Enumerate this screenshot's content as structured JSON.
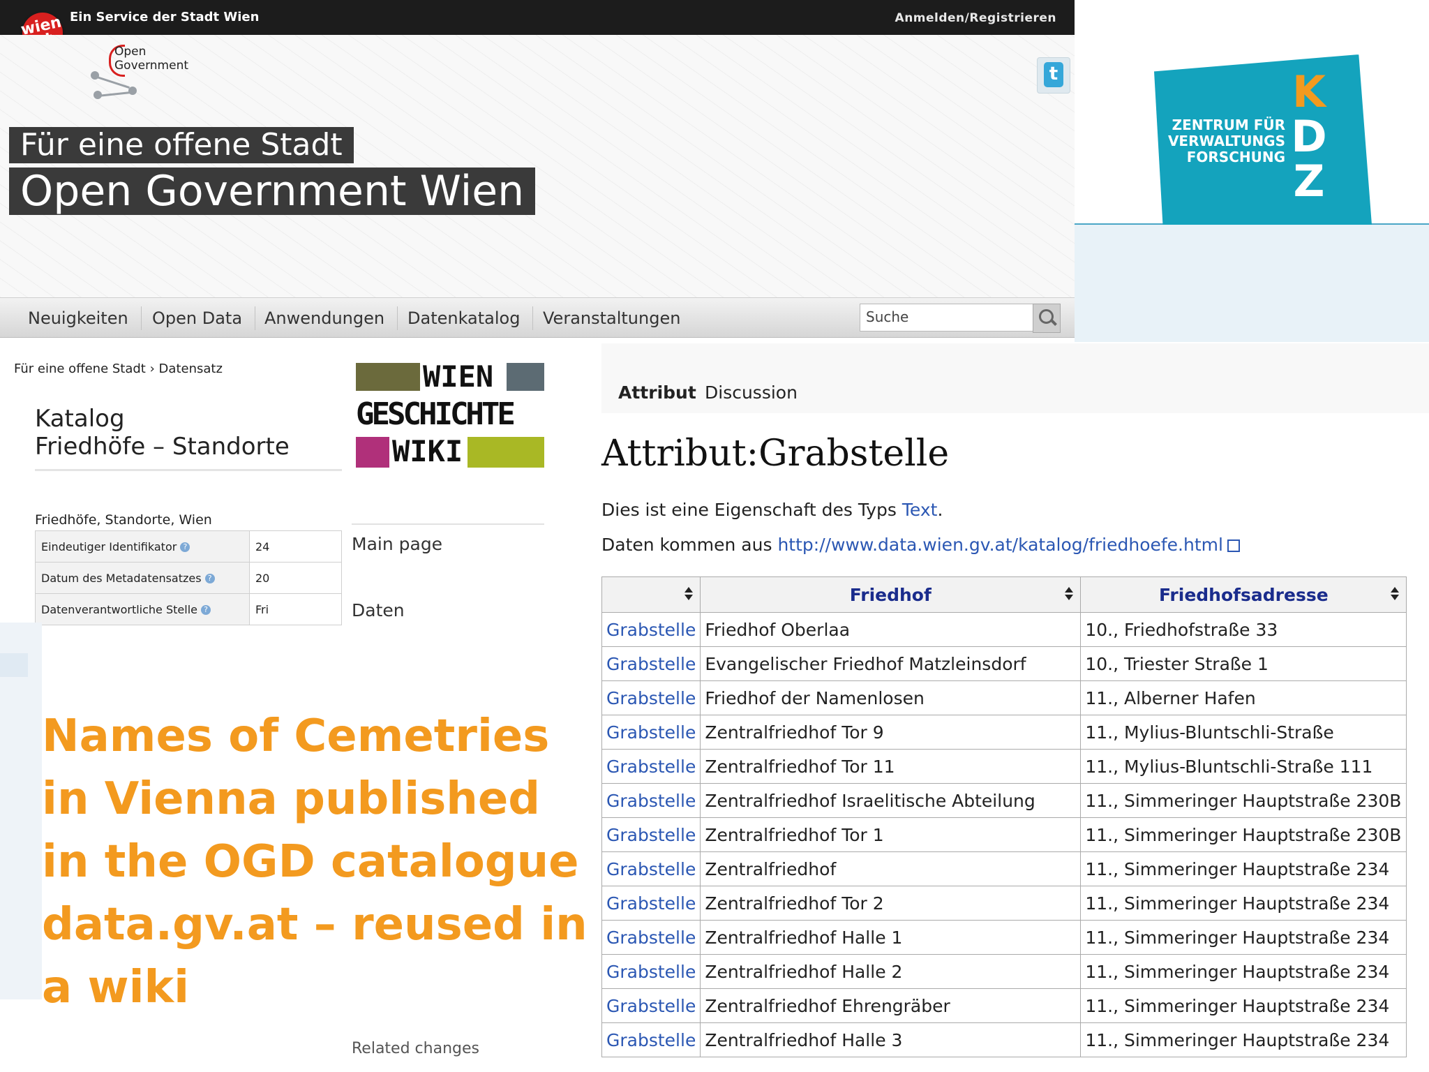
{
  "topbar": {
    "wien_logo": "wien at",
    "service": "Ein Service der Stadt Wien",
    "login": "Anmelden/Registrieren"
  },
  "header": {
    "og_logo": "Open Government",
    "title_small": "Für eine offene Stadt",
    "title_big": "Open Government Wien",
    "twitter_icon": "twitter-icon"
  },
  "nav": {
    "items": [
      "Neuigkeiten",
      "Open Data",
      "Anwendungen",
      "Datenkatalog",
      "Veranstaltungen"
    ],
    "search_placeholder": "Suche"
  },
  "kdz": {
    "line1": "ZENTRUM FÜR",
    "line2": "VERWALTUNGS",
    "line3": "FORSCHUNG",
    "letters": [
      "K",
      "D",
      "Z"
    ],
    "color": "#14a3bd",
    "accent": "#f39a1f"
  },
  "left": {
    "breadcrumb_1": "Für eine offene Stadt",
    "breadcrumb_2": "Datensatz",
    "katalog_line1": "Katalog",
    "katalog_line2": "Friedhöfe – Standorte",
    "subhead": "Friedhöfe, Standorte, Wien",
    "meta": [
      {
        "key": "Eindeutiger Identifikator",
        "value": "24"
      },
      {
        "key": "Datum des Metadatensatzes",
        "value": "20"
      },
      {
        "key": "Datenverantwortliche Stelle",
        "value": "Fri"
      }
    ]
  },
  "wgw_logo": {
    "line1": "WIEN",
    "line2": "GESCHICHTE",
    "line3": "WIKI"
  },
  "wiki_nav": {
    "main": "Main page",
    "daten": "Daten",
    "related": "Related changes"
  },
  "headline": {
    "line1": "Names of Cemetries",
    "line2": "in Vienna published",
    "line3": "in the OGD catalogue",
    "line4": "data.gv.at – reused in",
    "line5": "a wiki",
    "color": "#f39a1f"
  },
  "wiki": {
    "tab_attribut": "Attribut",
    "tab_discussion": "Discussion",
    "title": "Attribut:Grabstelle",
    "p1_prefix": "Dies ist eine Eigenschaft des Typs",
    "p1_link": "Text",
    "p1_suffix": ".",
    "p2_prefix": "Daten kommen aus",
    "p2_link": "http://www.data.wien.gv.at/katalog/friedhoefe.html",
    "table": {
      "headers": [
        "",
        "Friedhof",
        "Friedhofsadresse"
      ],
      "rows": [
        [
          "Grabstelle",
          "Friedhof Oberlaa",
          "10., Friedhofstraße 33"
        ],
        [
          "Grabstelle",
          "Evangelischer Friedhof Matzleinsdorf",
          "10., Triester Straße 1"
        ],
        [
          "Grabstelle",
          "Friedhof der Namenlosen",
          "11., Alberner Hafen"
        ],
        [
          "Grabstelle",
          "Zentralfriedhof Tor 9",
          "11., Mylius-Bluntschli-Straße"
        ],
        [
          "Grabstelle",
          "Zentralfriedhof Tor 11",
          "11., Mylius-Bluntschli-Straße 111"
        ],
        [
          "Grabstelle",
          "Zentralfriedhof Israelitische Abteilung",
          "11., Simmeringer Hauptstraße 230B"
        ],
        [
          "Grabstelle",
          "Zentralfriedhof Tor 1",
          "11., Simmeringer Hauptstraße 230B"
        ],
        [
          "Grabstelle",
          "Zentralfriedhof",
          "11., Simmeringer Hauptstraße 234"
        ],
        [
          "Grabstelle",
          "Zentralfriedhof Tor 2",
          "11., Simmeringer Hauptstraße 234"
        ],
        [
          "Grabstelle",
          "Zentralfriedhof Halle 1",
          "11., Simmeringer Hauptstraße 234"
        ],
        [
          "Grabstelle",
          "Zentralfriedhof Halle 2",
          "11., Simmeringer Hauptstraße 234"
        ],
        [
          "Grabstelle",
          "Zentralfriedhof Ehrengräber",
          "11., Simmeringer Hauptstraße 234"
        ],
        [
          "Grabstelle",
          "Zentralfriedhof Halle 3",
          "11., Simmeringer Hauptstraße 234"
        ]
      ]
    }
  }
}
